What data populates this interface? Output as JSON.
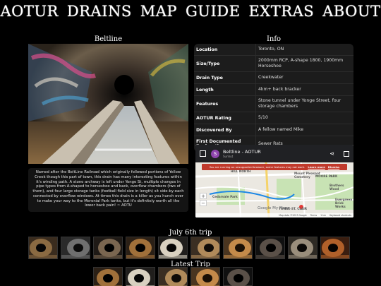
{
  "nav": [
    "AOTUR",
    "DRAINS",
    "MAP",
    "GUIDE",
    "EXTRAS",
    "ABOUT"
  ],
  "headings": {
    "photo": "Beltline",
    "info": "Info",
    "july_trip": "July 6th trip",
    "latest_trip": "Latest Trip"
  },
  "description": "Named after the BeltLine Railroad which originally followed portions of Yellow Creek though this part of town, this drain has many interesting features within it's winding path. A stone archway is left under Yonge St, multiple changes in pipe types from A-shaped to horseshoe and back, overflow chambers (two of them), and four large storage tanks (football field size in length) sit side-by-each connected by overflow windows. At times this drain is a killer as you hunch over to make your way to the Meronial Park tanks, but it's definitely worth all the lower back pain! ~ AOTU",
  "info": [
    {
      "key": "Location",
      "value": "Toronto, ON"
    },
    {
      "key": "Size/Type",
      "value": "2000mm RCP, A-shape 1800, 1900mm Horseshoe"
    },
    {
      "key": "Drain Type",
      "value": "Creekwater"
    },
    {
      "key": "Length",
      "value": "4km+ back bracker"
    },
    {
      "key": "Features",
      "value": "Stone tunnel under Yonge Street, four storage chambers"
    },
    {
      "key": "AOTUR Rating",
      "value": "5/10"
    },
    {
      "key": "Discovered By",
      "value": "A fellow named Mike"
    },
    {
      "key": "First Documented Exploration",
      "value": "Sewer Rats"
    }
  ],
  "map": {
    "avatar": "S",
    "title": "Beltline - AOTUR",
    "subtitle": "Sunhut",
    "banner": "You are running an unsupported browser, some features may not work.",
    "banner_link": "Learn more",
    "dismiss": "Dismiss",
    "labels": [
      "HILL NORTH",
      "Cedarvale Park",
      "Mount Pleasant Cemetery",
      "Brothers Wood",
      "YONGE-ST. CLAIR",
      "Evergreen Brick Works",
      "Cedarvale Park",
      "MOORE PARK"
    ],
    "brand": "Google My Maps",
    "footer": [
      "Map data ©2023 Google",
      "Terms",
      "1 km",
      "Keyboard shortcuts"
    ],
    "zoom_in": "+",
    "zoom_out": "−"
  },
  "colors": {
    "background": "#000000",
    "info_bg": "#1c1c1c",
    "banner": "#c0392b",
    "avatar": "#8e44ad"
  },
  "july_thumbs": [
    "graffiti-tunnel",
    "stone-arch",
    "round-pipe",
    "horseshoe-pipe",
    "explorer-with-light",
    "tank-chamber",
    "brick-tunnel",
    "dark-opening",
    "concrete-room",
    "rusty-pipe"
  ],
  "latest_thumbs": [
    "orange-pipe",
    "explorer-a-shape",
    "tank-columns",
    "flooded-chamber",
    "dark-pipe"
  ]
}
